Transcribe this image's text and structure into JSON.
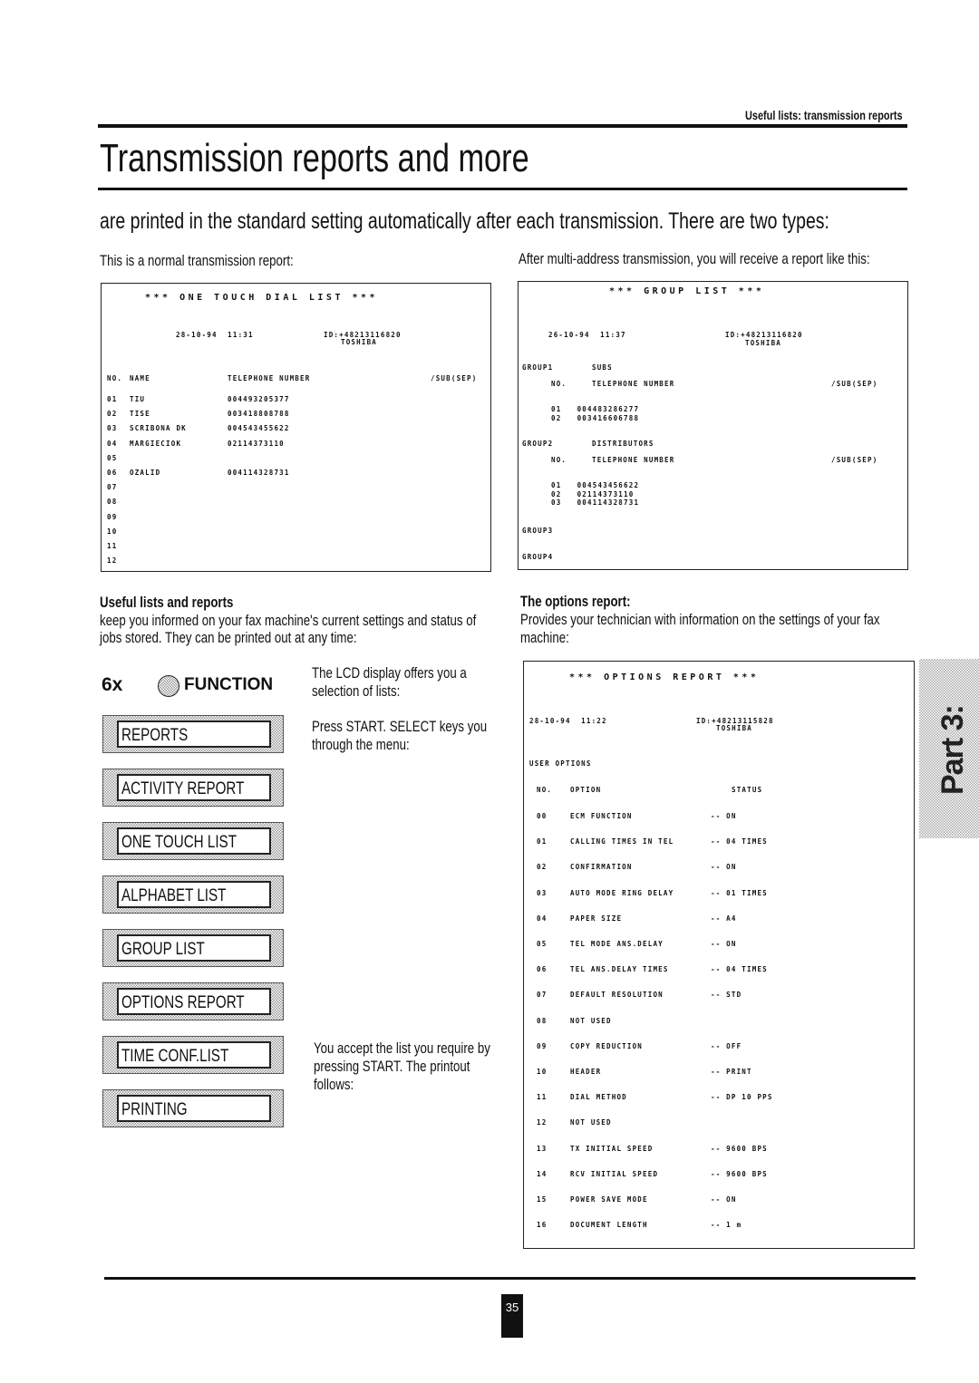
{
  "header": {
    "running_title": "Useful lists: transmission reports",
    "title": "Transmission reports and more",
    "intro": "are printed in the standard setting automatically after each transmission.  There are two types:"
  },
  "left_caption": "This is a normal transmission report:",
  "right_caption": "After multi-address transmission, you will receive a report like this:",
  "one_touch": {
    "title": "*** ONE TOUCH DIAL LIST ***",
    "date": "28-10-94  11:31",
    "id": "ID:+48213116820",
    "id_name": "TOSHIBA",
    "headers": [
      "NO.",
      "NAME",
      "TELEPHONE NUMBER",
      "/SUB(SEP)"
    ],
    "rows": [
      [
        "01",
        "TIU",
        "004493205377"
      ],
      [
        "02",
        "TISE",
        "003418808788"
      ],
      [
        "03",
        "SCRIBONA DK",
        "004543455622"
      ],
      [
        "04",
        "MARGIECIOK",
        "02114373110"
      ],
      [
        "05",
        "",
        ""
      ],
      [
        "06",
        "OZALID",
        "004114328731"
      ],
      [
        "07",
        "",
        ""
      ],
      [
        "08",
        "",
        ""
      ],
      [
        "09",
        "",
        ""
      ],
      [
        "10",
        "",
        ""
      ],
      [
        "11",
        "",
        ""
      ],
      [
        "12",
        "",
        ""
      ]
    ]
  },
  "group_list": {
    "title": "*** GROUP LIST ***",
    "date": "26-10-94  11:37",
    "id": "ID:+48213116820",
    "id_name": "TOSHIBA",
    "groups": [
      {
        "label": "GROUP1",
        "name": "SUBS",
        "hdr_no": "NO.",
        "hdr_tel": "TELEPHONE NUMBER",
        "hdr_sub": "/SUB(SEP)",
        "rows": [
          "01   004483286277",
          "02   003416606788"
        ]
      },
      {
        "label": "GROUP2",
        "name": "DISTRIBUTORS",
        "hdr_no": "NO.",
        "hdr_tel": "TELEPHONE NUMBER",
        "hdr_sub": "/SUB(SEP)",
        "rows": [
          "01   004543456622",
          "02   02114373110",
          "03   004114328731"
        ]
      },
      {
        "label": "GROUP3"
      },
      {
        "label": "GROUP4"
      }
    ]
  },
  "useful": {
    "heading": "Useful lists and reports",
    "text1": "keep you informed on your fax machine's current settings and status of",
    "text2": "jobs stored.  They can be printed out at any time:"
  },
  "options": {
    "heading": "The options report:",
    "text1": "Provides your technician with information on the settings of your fax",
    "text2": "machine:"
  },
  "function": {
    "count": "6x",
    "label": "FUNCTION"
  },
  "lcd_items": [
    "REPORTS",
    "ACTIVITY REPORT",
    "ONE TOUCH LIST",
    "ALPHABET LIST",
    "GROUP LIST",
    "OPTIONS REPORT",
    "TIME CONF.LIST",
    "PRINTING"
  ],
  "notes": {
    "n1a": "The LCD display offers you a",
    "n1b": "selection of lists:",
    "n2a": "Press START.  SELECT keys you",
    "n2b": "through the menu:",
    "n3a": "You accept the list you require by",
    "n3b": "pressing START.  The printout",
    "n3c": "follows:"
  },
  "options_report": {
    "title": "*** OPTIONS REPORT ***",
    "date": "28-10-94  11:22",
    "id": "ID:+48213115828",
    "id_name": "TOSHIBA",
    "section": "USER OPTIONS",
    "headers": [
      "NO.",
      "OPTION",
      "STATUS"
    ],
    "rows": [
      [
        "00",
        "ECM FUNCTION",
        "-- ON"
      ],
      [
        "01",
        "CALLING TIMES IN TEL",
        "-- 04 TIMES"
      ],
      [
        "02",
        "CONFIRMATION",
        "-- ON"
      ],
      [
        "03",
        "AUTO MODE RING DELAY",
        "-- 01 TIMES"
      ],
      [
        "04",
        "PAPER SIZE",
        "-- A4"
      ],
      [
        "05",
        "TEL MODE ANS.DELAY",
        "-- ON"
      ],
      [
        "06",
        "TEL ANS.DELAY TIMES",
        "-- 04 TIMES"
      ],
      [
        "07",
        "DEFAULT RESOLUTION",
        "-- STD"
      ],
      [
        "08",
        "NOT USED",
        ""
      ],
      [
        "09",
        "COPY REDUCTION",
        "-- OFF"
      ],
      [
        "10",
        "HEADER",
        "-- PRINT"
      ],
      [
        "11",
        "DIAL METHOD",
        "-- DP 10 PPS"
      ],
      [
        "12",
        "NOT USED",
        ""
      ],
      [
        "13",
        "TX INITIAL SPEED",
        "-- 9600 BPS"
      ],
      [
        "14",
        "RCV INITIAL SPEED",
        "-- 9600 BPS"
      ],
      [
        "15",
        "POWER SAVE MODE",
        "-- ON"
      ],
      [
        "16",
        "DOCUMENT LENGTH",
        "-- 1 m"
      ]
    ]
  },
  "tab": "Part 3:",
  "page_number": "35"
}
